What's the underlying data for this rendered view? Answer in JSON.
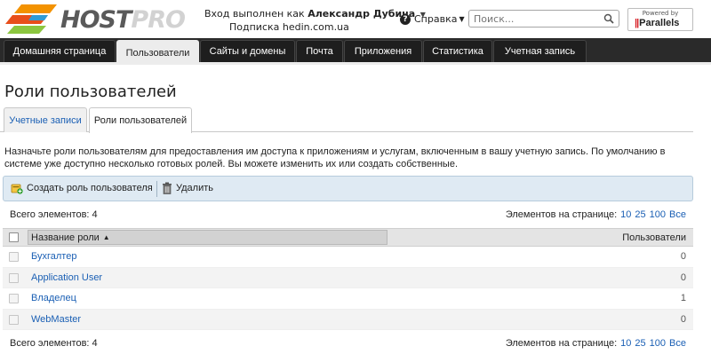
{
  "header": {
    "logo_text_main": "HOST",
    "logo_text_accent": "PRO",
    "login_label": "Вход выполнен как",
    "user_name": "Александр Дубина",
    "subscription_label": "Подписка",
    "subscription_value": "hedin.com.ua",
    "help_label": "Справка",
    "search_placeholder": "Поиск...",
    "powered_by": "Powered by",
    "parallels": "Parallels"
  },
  "nav": {
    "tabs": [
      {
        "label": "Домашняя страница",
        "active": false
      },
      {
        "label": "Пользователи",
        "active": true
      },
      {
        "label": "Сайты и домены",
        "active": false
      },
      {
        "label": "Почта",
        "active": false
      },
      {
        "label": "Приложения",
        "active": false
      },
      {
        "label": "Статистика",
        "active": false
      },
      {
        "label": "Учетная запись",
        "active": false
      }
    ]
  },
  "page": {
    "title": "Роли пользователей",
    "subtabs": [
      {
        "label": "Учетные записи",
        "active": false
      },
      {
        "label": "Роли пользователей",
        "active": true
      }
    ],
    "description": "Назначьте роли пользователям для предоставления им доступа к приложениям и услугам, включенным в вашу учетную запись. По умолчанию в системе уже доступно несколько готовых ролей. Вы можете изменить их или создать собственные."
  },
  "toolbar": {
    "create_label": "Создать роль пользователя",
    "delete_label": "Удалить"
  },
  "list": {
    "total_label": "Всего элементов: 4",
    "per_page_label": "Элементов на странице:",
    "per_page_options": [
      "10",
      "25",
      "100",
      "Все"
    ],
    "col_name": "Название роли",
    "col_users": "Пользователи",
    "rows": [
      {
        "name": "Бухгалтер",
        "users": "0"
      },
      {
        "name": "Application User",
        "users": "0"
      },
      {
        "name": "Владелец",
        "users": "1"
      },
      {
        "name": "WebMaster",
        "users": "0"
      }
    ]
  },
  "colors": {
    "nav_bg": "#2a2a2a",
    "link": "#1a5fb4",
    "toolbar_bg": "#dfeaf3",
    "logo_orange": "#f39200",
    "logo_green": "#8cc63f"
  }
}
